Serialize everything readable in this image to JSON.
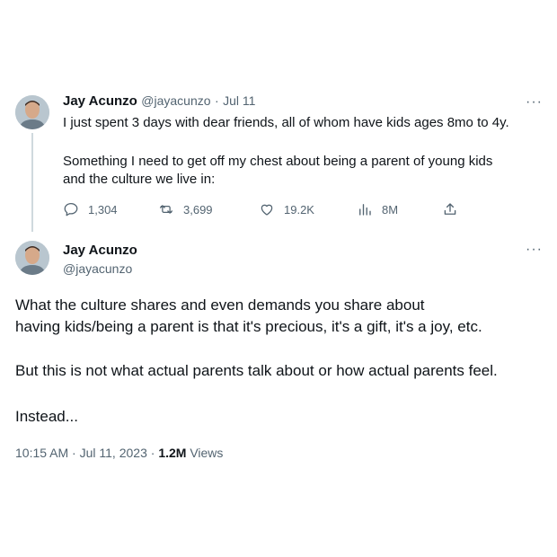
{
  "reply": {
    "author_name": "Jay Acunzo",
    "handle": "@jayacunzo",
    "separator": "·",
    "date": "Jul 11",
    "text_line1": "I just spent 3 days with dear friends, all of whom have kids ages 8mo to 4y.",
    "text_line2": "Something I need to get off my chest about being a parent of young kids",
    "text_line3": "and the culture we live in:",
    "stats": {
      "replies": "1,304",
      "retweets": "3,699",
      "likes": "19.2K",
      "views": "8M"
    },
    "more_label": "···"
  },
  "main": {
    "author_name": "Jay Acunzo",
    "handle": "@jayacunzo",
    "more_label": "···",
    "para1_line1": "What the culture shares and even demands you share about",
    "para1_line2": "having kids/being a parent is that it's precious, it's a gift, it's a joy, etc.",
    "para2": "But this is not what actual parents talk about or how actual parents feel.",
    "para3": "Instead...",
    "time": "10:15 AM",
    "date": "Jul 11, 2023",
    "sep1": "·",
    "sep2": "·",
    "views_count": "1.2M",
    "views_label": "Views"
  },
  "icons": {
    "reply": "comment-icon",
    "retweet": "retweet-icon",
    "like": "heart-icon",
    "views": "bar-chart-icon",
    "share": "share-icon"
  },
  "colors": {
    "text": "#0f1419",
    "muted": "#536471",
    "thread_line": "#cfd9de"
  }
}
